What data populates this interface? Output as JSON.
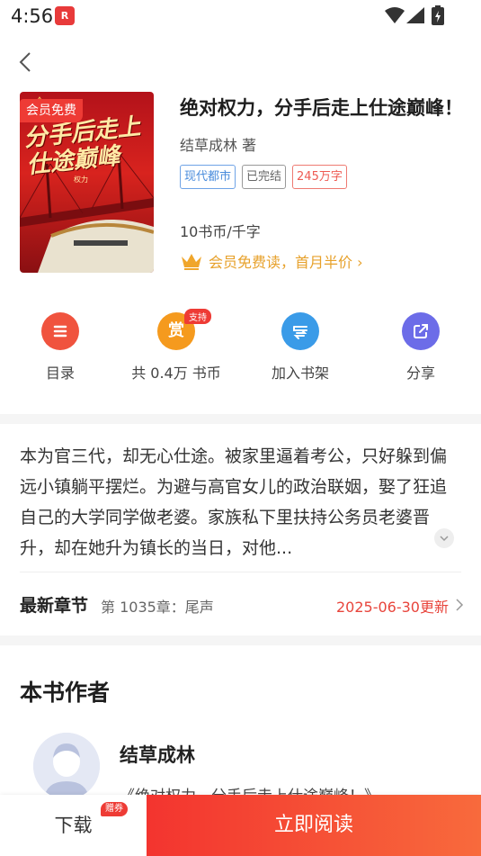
{
  "status_bar": {
    "time": "4:56",
    "app_icon_text": "R"
  },
  "book": {
    "cover_badge": "会员免费",
    "cover_title": "分手后走上仕途巅峰",
    "cover_tag": "权力",
    "title": "绝对权力，分手后走上仕途巅峰！",
    "author_line": "结草成林 著",
    "tags": [
      "现代都市",
      "已完结",
      "245万字"
    ],
    "price": "10书币/千字",
    "vip_text": "会员免费读，首月半价 ›"
  },
  "actions": [
    {
      "label": "目录",
      "icon": "list-icon",
      "color": "#f0533e"
    },
    {
      "label": "共 0.4万 书币",
      "icon": "reward-icon",
      "badge": "支持",
      "glyph": "赏",
      "color": "#f59a1e"
    },
    {
      "label": "加入书架",
      "icon": "bookshelf-icon",
      "color": "#3a9be8"
    },
    {
      "label": "分享",
      "icon": "share-icon",
      "color": "#6c6ce8"
    }
  ],
  "intro": "本为官三代，却无心仕途。被家里逼着考公，只好躲到偏远小镇躺平摆烂。为避与高官女儿的政治联姻，娶了狂追自己的大学同学做老婆。家族私下里扶持公务员老婆晋升，却在她升为镇长的当日，对他...",
  "latest": {
    "label": "最新章节",
    "chapter": "第 1035章：尾声",
    "date": "2025-06-30更新"
  },
  "author_section": {
    "heading": "本书作者",
    "name": "结草成林",
    "work": "《绝对权力，分手后走上仕途巅峰！》"
  },
  "bottom_bar": {
    "download": "下载",
    "coupon": "赠券",
    "read": "立即阅读"
  }
}
